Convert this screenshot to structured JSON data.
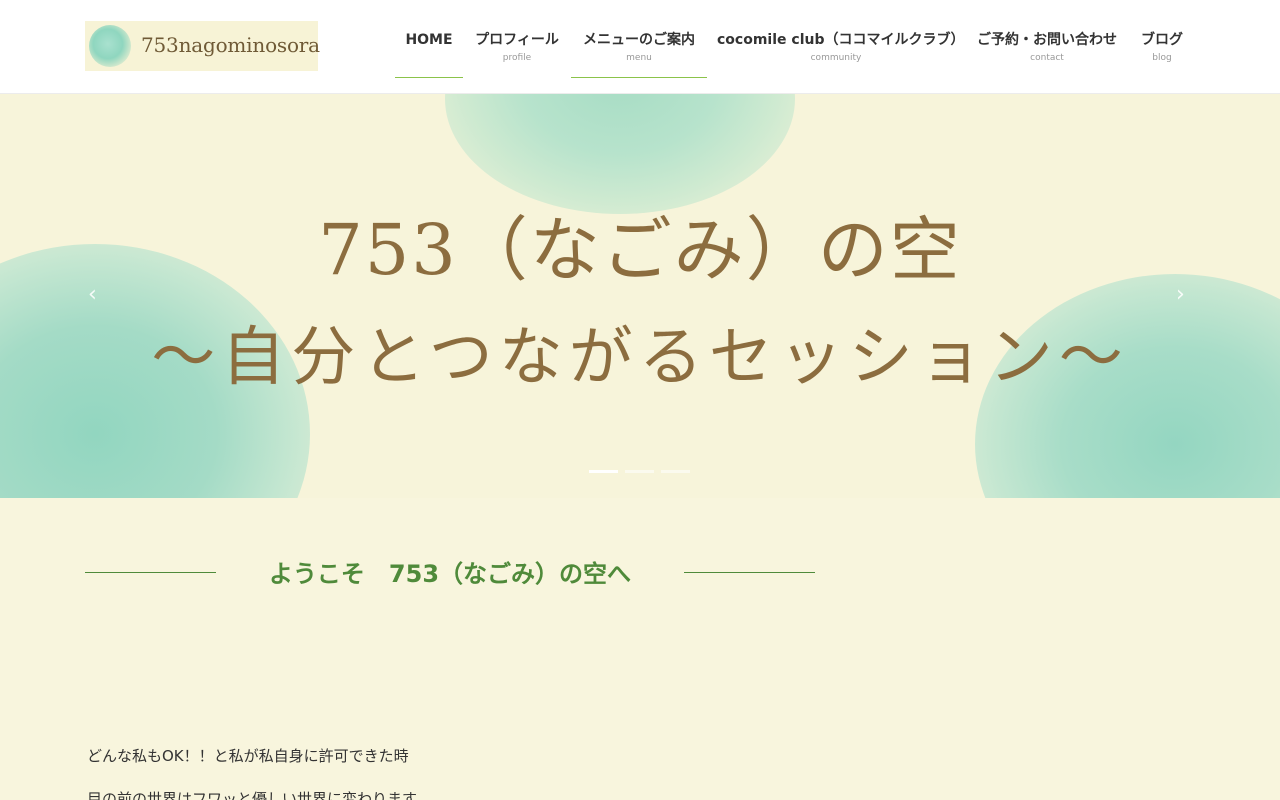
{
  "header": {
    "logo_text": "753nagominosora",
    "nav": [
      {
        "label": "HOME",
        "sub": ""
      },
      {
        "label": "プロフィール",
        "sub": "profile"
      },
      {
        "label": "メニューのご案内",
        "sub": "menu"
      },
      {
        "label": "cocomile club（ココマイルクラブ）",
        "sub": "community"
      },
      {
        "label": "ご予約・お問い合わせ",
        "sub": "contact"
      },
      {
        "label": "ブログ",
        "sub": "blog"
      }
    ]
  },
  "hero": {
    "line1": "753（なごみ）の空",
    "line2": "～自分とつながるセッション～",
    "prev_arrow": "‹",
    "next_arrow": "›",
    "slide_count": 3,
    "active_slide": 1
  },
  "welcome": {
    "heading": "ようこそ　753（なごみ）の空へ",
    "paragraphs": [
      "どんな私もOK！！と私が私自身に許可できた時",
      "目の前の世界はフワッと優しい世界に変わります"
    ]
  },
  "colors": {
    "accent_green": "#4f8a3a",
    "nav_underline": "#8bc34a",
    "hero_text": "#8c6d3f",
    "background": "#f8f5dd"
  }
}
